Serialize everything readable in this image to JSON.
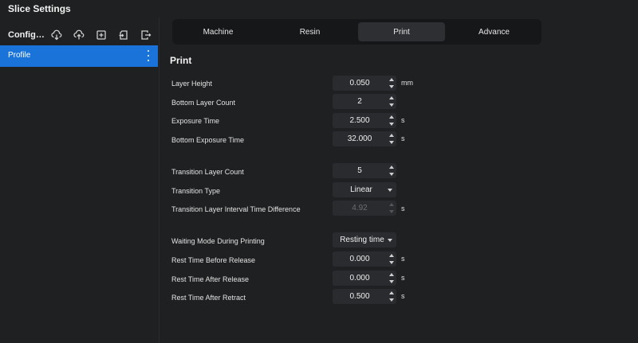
{
  "window": {
    "title": "Slice Settings"
  },
  "sidebar": {
    "title": "Configur...",
    "tools": [
      "cloud-download-icon",
      "cloud-upload-icon",
      "add-file-icon",
      "import-icon",
      "export-icon"
    ],
    "items": [
      {
        "label": "Profile",
        "selected": true
      }
    ]
  },
  "tabs": [
    {
      "label": "Machine",
      "active": false
    },
    {
      "label": "Resin",
      "active": false
    },
    {
      "label": "Print",
      "active": true
    },
    {
      "label": "Advance",
      "active": false
    }
  ],
  "section": {
    "title": "Print"
  },
  "rows": {
    "layer_height": {
      "label": "Layer Height",
      "value": "0.050",
      "unit": "mm"
    },
    "bottom_layer_count": {
      "label": "Bottom Layer Count",
      "value": "2",
      "unit": ""
    },
    "exposure_time": {
      "label": "Exposure Time",
      "value": "2.500",
      "unit": "s"
    },
    "bottom_exposure_time": {
      "label": "Bottom Exposure Time",
      "value": "32.000",
      "unit": "s"
    },
    "transition_layer_count": {
      "label": "Transition Layer Count",
      "value": "5",
      "unit": ""
    },
    "transition_type": {
      "label": "Transition Type",
      "value": "Linear"
    },
    "transition_interval": {
      "label": "Transition Layer Interval Time Difference",
      "value": "4.92",
      "unit": "s",
      "disabled": true
    },
    "waiting_mode": {
      "label": "Waiting Mode During Printing",
      "value": "Resting time"
    },
    "rest_before_release": {
      "label": "Rest Time Before Release",
      "value": "0.000",
      "unit": "s"
    },
    "rest_after_release": {
      "label": "Rest Time After Release",
      "value": "0.000",
      "unit": "s"
    },
    "rest_after_retract": {
      "label": "Rest Time After Retract",
      "value": "0.500",
      "unit": "s"
    }
  },
  "colors": {
    "accent": "#1a73d9",
    "background": "#1f2022",
    "field": "#2a2b2e"
  }
}
